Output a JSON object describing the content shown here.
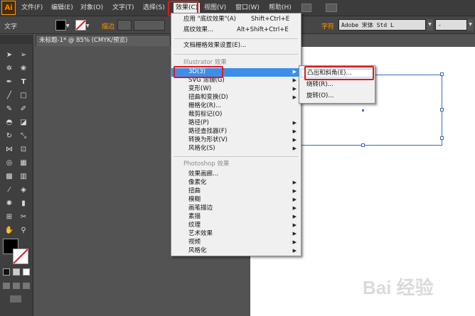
{
  "app": {
    "logo": "Ai"
  },
  "menubar": {
    "items": [
      "文件(F)",
      "编辑(E)",
      "对象(O)",
      "文字(T)",
      "选择(S)",
      "效果(C)",
      "视图(V)",
      "窗口(W)",
      "帮助(H)"
    ]
  },
  "controlbar": {
    "tool_label": "文字",
    "stroke_label": "描边",
    "char_label": "字符",
    "font_value": "Adobe 宋体 Std L",
    "style_value": "-"
  },
  "document": {
    "tab_title": "未标题-1* @ 85% (CMYK/预览)"
  },
  "effect_menu": {
    "apply_last": {
      "label": "应用 \"底纹效果\"(A)",
      "shortcut": "Shift+Ctrl+E"
    },
    "last_effect": {
      "label": "底纹效果...",
      "shortcut": "Alt+Shift+Ctrl+E"
    },
    "raster_settings": "文档栅格效果设置(E)...",
    "illustrator_header": "Illustrator 效果",
    "illustrator_items": [
      "3D(3)",
      "SVG 滤镜(G)",
      "变形(W)",
      "扭曲和变换(D)",
      "栅格化(R)...",
      "裁剪标记(O)",
      "路径(P)",
      "路径查找器(F)",
      "转换为形状(V)",
      "风格化(S)"
    ],
    "photoshop_header": "Photoshop 效果",
    "photoshop_items": [
      "效果画廊...",
      "像素化",
      "扭曲",
      "模糊",
      "画笔描边",
      "素描",
      "纹理",
      "艺术效果",
      "视频",
      "风格化"
    ]
  },
  "submenu_3d": {
    "items": [
      "凸出和斜角(E)...",
      "绕转(R)...",
      "旋转(O)..."
    ]
  },
  "watermark": {
    "text": "Bai 经验"
  },
  "colors": {
    "accent_highlight": "#3d8ee8",
    "annotation_red": "#e2161b",
    "brand_orange": "#ff9a00"
  }
}
